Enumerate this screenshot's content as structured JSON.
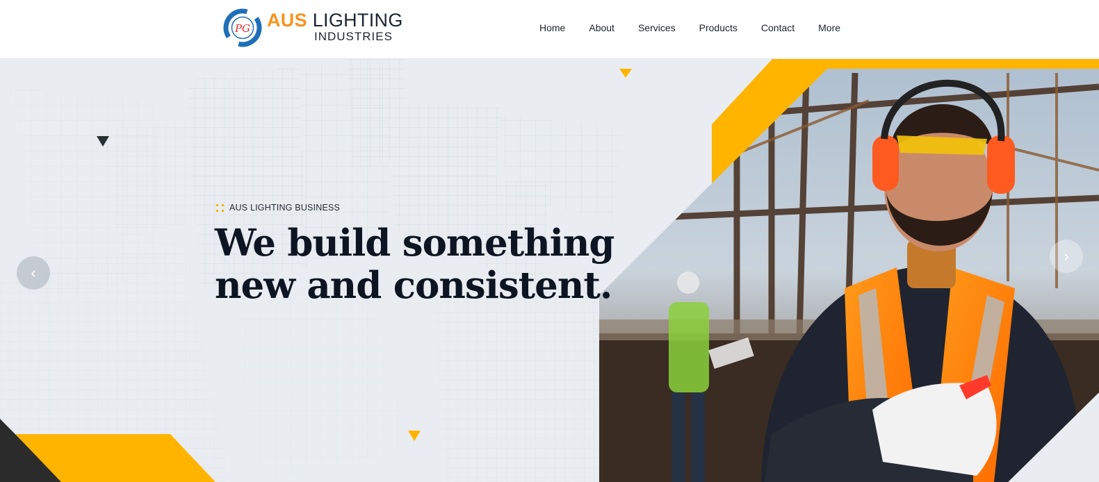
{
  "brand": {
    "name_highlight": "AUS",
    "name_rest": "LIGHTING",
    "subline": "INDUSTRIES",
    "monogram": "PG"
  },
  "nav": {
    "items": [
      {
        "label": "Home"
      },
      {
        "label": "About"
      },
      {
        "label": "Services"
      },
      {
        "label": "Products"
      },
      {
        "label": "Contact"
      },
      {
        "label": "More"
      }
    ]
  },
  "hero": {
    "eyebrow": "AUS LIGHTING BUSINESS",
    "headline_line1": "We build something",
    "headline_line2": "new and consistent.",
    "prev_icon": "chevron-left-icon",
    "next_icon": "chevron-right-icon",
    "prev_glyph": "‹",
    "next_glyph": "›"
  },
  "colors": {
    "accent": "#ffb400",
    "brand_orange": "#f7931e",
    "brand_blue": "#1f6fb8",
    "dark": "#0e1522",
    "hero_bg": "#e9edf1"
  }
}
